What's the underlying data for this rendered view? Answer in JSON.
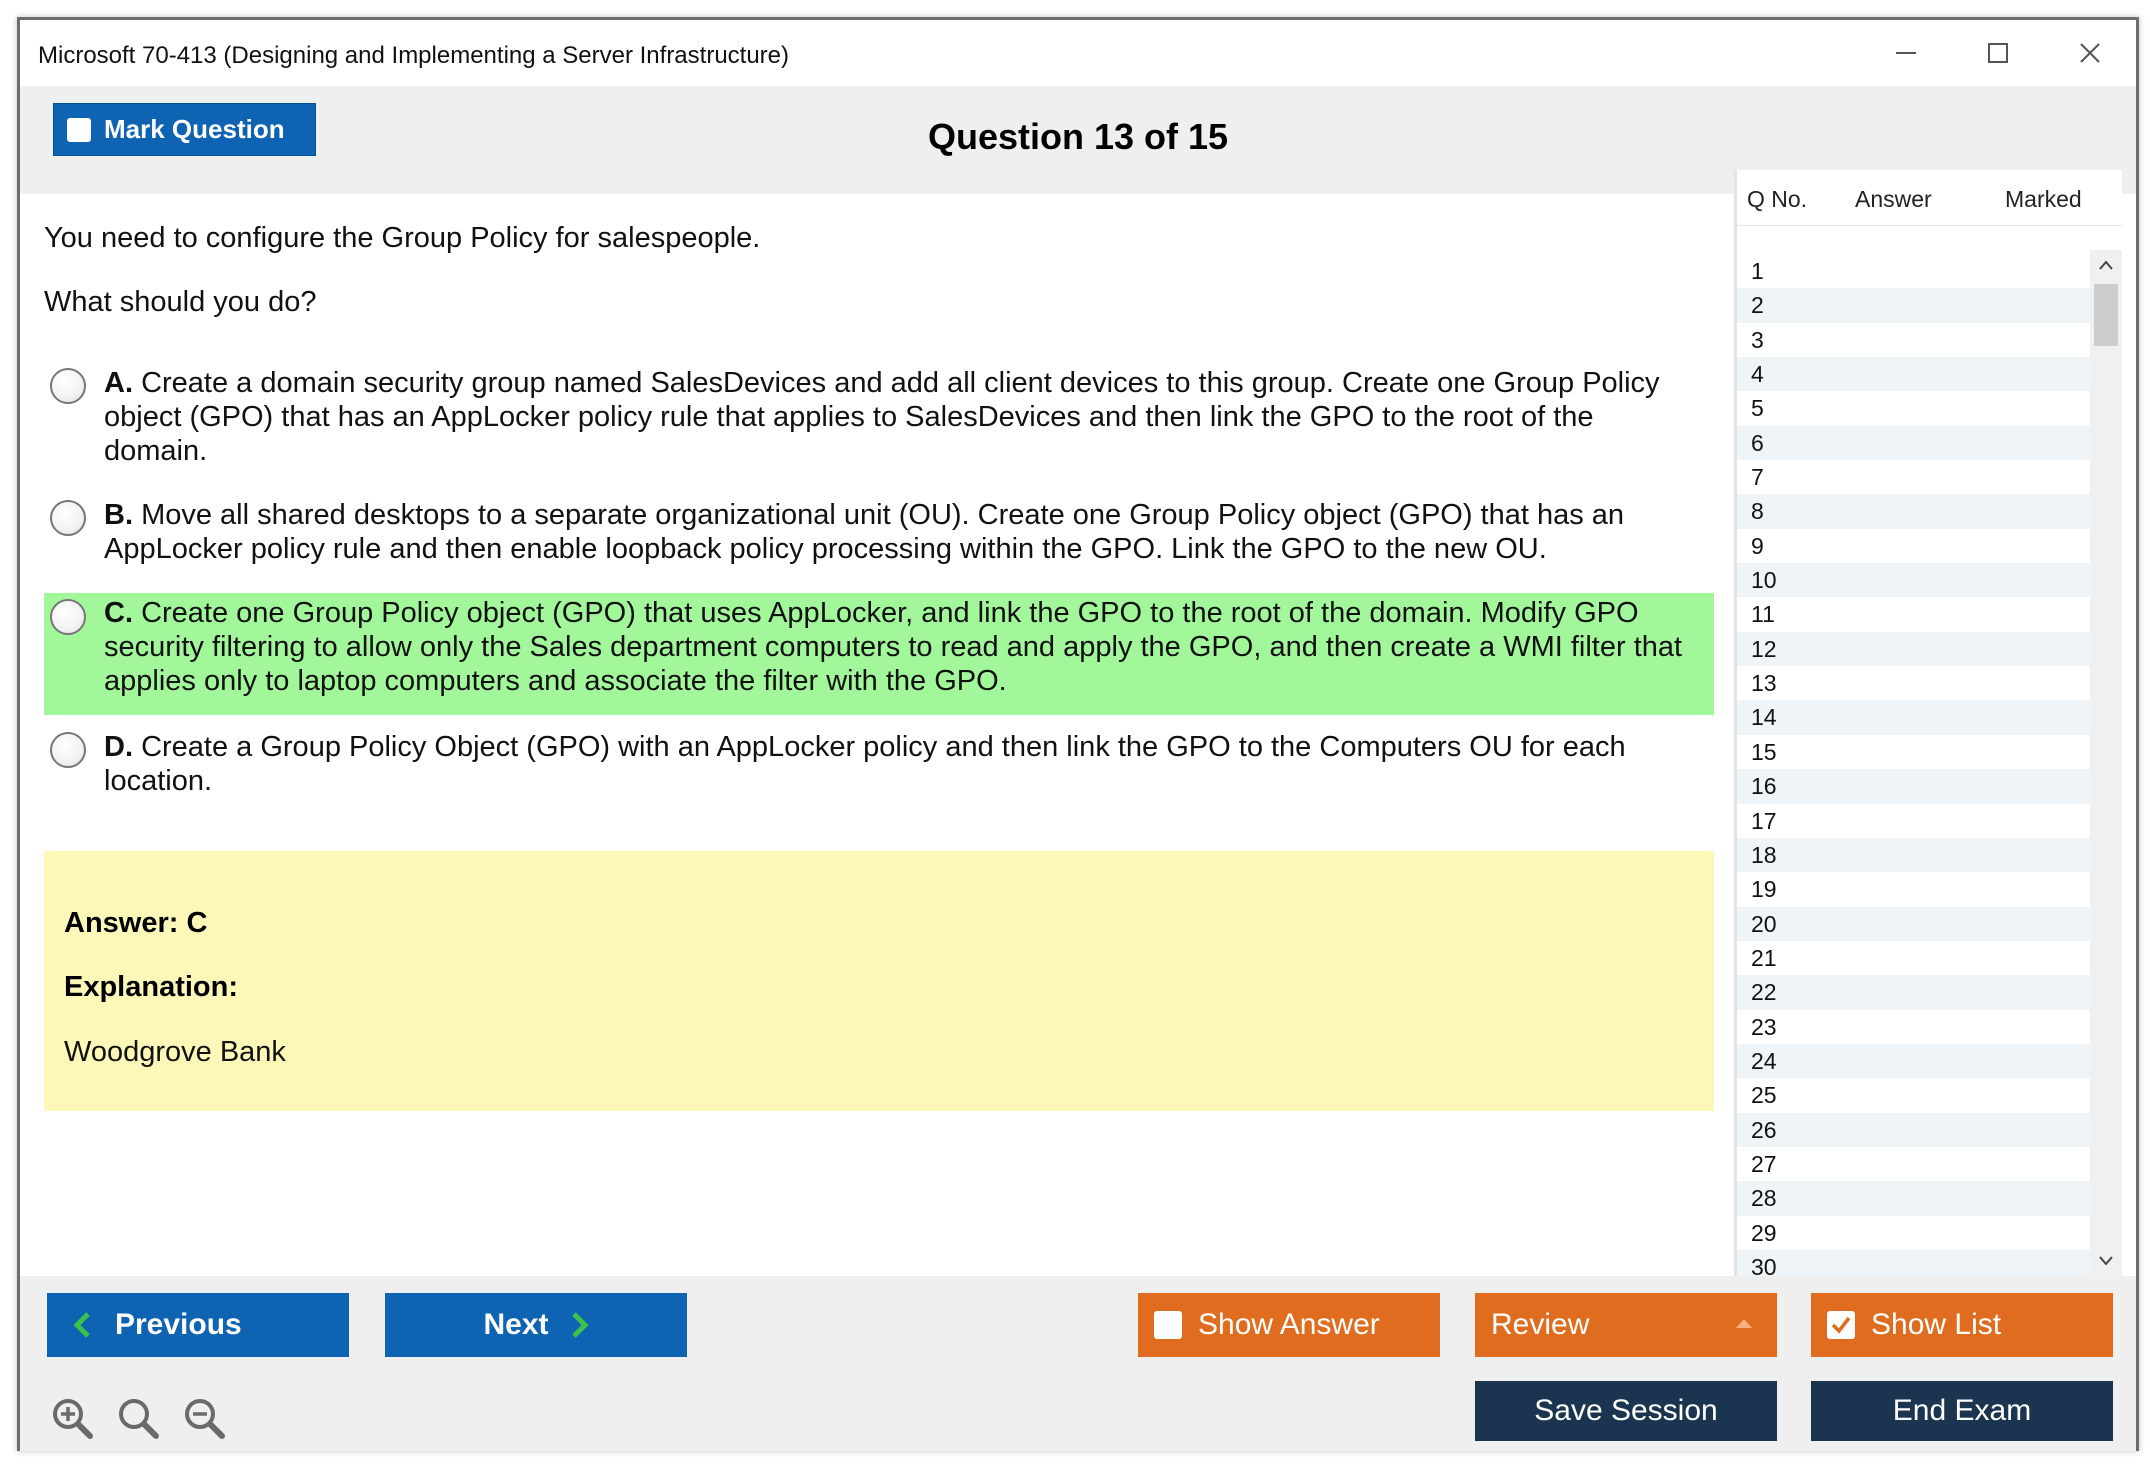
{
  "window": {
    "title": "Microsoft 70-413 (Designing and Implementing a Server Infrastructure)",
    "controls": [
      "minimize-icon",
      "maximize-icon",
      "close-icon"
    ]
  },
  "header": {
    "mark_label": "Mark Question",
    "question_title": "Question 13 of 15"
  },
  "question": {
    "prompt": "You need to configure the Group Policy for salespeople.",
    "ask": "What should you do?",
    "options": [
      {
        "letter": "A.",
        "text": "Create a domain security group named SalesDevices and add all client devices to this group. Create one Group Policy object (GPO) that has an AppLocker policy rule that applies to SalesDevices and then link the GPO to the root of the domain."
      },
      {
        "letter": "B.",
        "text": "Move all shared desktops to a separate organizational unit (OU). Create one Group Policy object (GPO) that has an AppLocker policy rule and then enable loopback policy processing within the GPO. Link the GPO to the new OU."
      },
      {
        "letter": "C.",
        "text": "Create one Group Policy object (GPO) that uses AppLocker, and link the GPO to the root of the domain. Modify GPO security filtering to allow only the Sales department computers to read and apply the GPO, and then create a WMI filter that applies only to laptop computers and associate the filter with the GPO."
      },
      {
        "letter": "D.",
        "text": "Create a Group Policy Object (GPO) with an AppLocker policy and then link the GPO to the Computers OU for each location."
      }
    ],
    "highlight_color": "#a2f79a"
  },
  "answer": {
    "answer_line": "Answer: C",
    "explanation_label": "Explanation:",
    "explanation_text": "Woodgrove Bank",
    "box_color": "#fdf7b8"
  },
  "sidebar": {
    "headers": [
      "Q No.",
      "Answer",
      "Marked"
    ],
    "rows": [
      "1",
      "2",
      "3",
      "4",
      "5",
      "6",
      "7",
      "8",
      "9",
      "10",
      "11",
      "12",
      "13",
      "14",
      "15",
      "16",
      "17",
      "18",
      "19",
      "20",
      "21",
      "22",
      "23",
      "24",
      "25",
      "26",
      "27",
      "28",
      "29",
      "30"
    ]
  },
  "footer": {
    "previous_label": "Previous",
    "next_label": "Next",
    "show_answer_label": "Show Answer",
    "review_label": "Review",
    "show_list_label": "Show List",
    "save_session_label": "Save Session",
    "end_exam_label": "End Exam",
    "zoom_icons": [
      "zoom-in-icon",
      "zoom-reset-icon",
      "zoom-out-icon"
    ]
  },
  "colors": {
    "primary_blue": "#0e63b2",
    "orange": "#e06d1f",
    "navy": "#1b3550",
    "chevron_green": "#39c34a"
  }
}
